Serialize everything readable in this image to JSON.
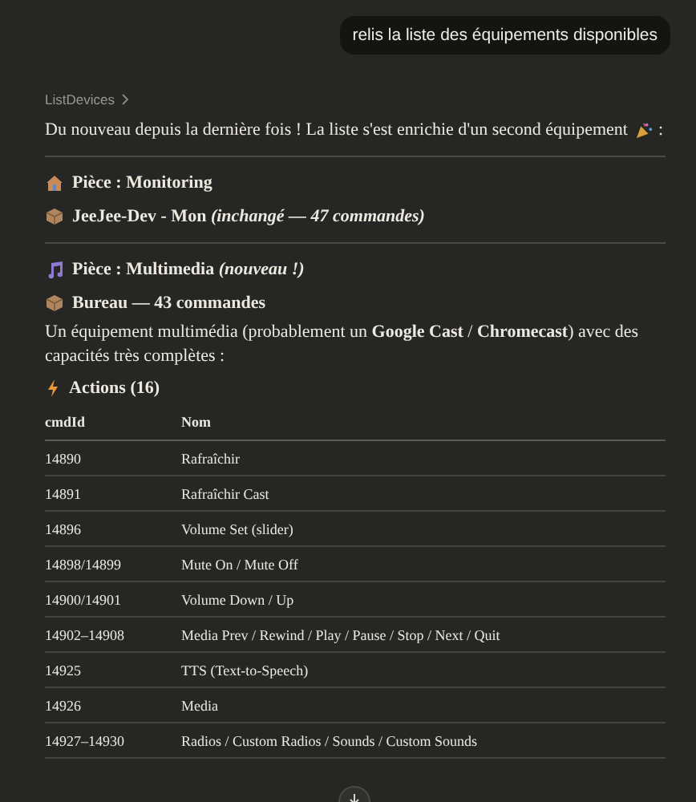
{
  "user_message": "relis la liste des équipements disponibles",
  "breadcrumb": "ListDevices",
  "intro": "Du nouveau depuis la dernière fois ! La liste s'est enrichie d'un second équipement",
  "intro_end": ":",
  "rooms": [
    {
      "title": "Pièce : Monitoring",
      "devices": [
        {
          "title": "JeeJee-Dev - Mon *(inchangé — 47 commandes)*"
        }
      ]
    },
    {
      "title": "Pièce : Multimedia *(nouveau !)*",
      "devices": [
        {
          "title": "Bureau — 43 commandes",
          "description": "Un équipement multimédia (probablement un **Google Cast** / **Chromecast**) avec des capacités très complètes :",
          "actions": {
            "title": "Actions (16)",
            "columns": [
              "cmdId",
              "Nom"
            ],
            "rows": [
              [
                "14890",
                "Rafraîchir"
              ],
              [
                "14891",
                "Rafraîchir Cast"
              ],
              [
                "14896",
                "Volume Set (slider)"
              ],
              [
                "14898/14899",
                "Mute On / Mute Off"
              ],
              [
                "14900/14901",
                "Volume Down / Up"
              ],
              [
                "14902–14908",
                "Media Prev / Rewind / Play / Pause / Stop / Next / Quit"
              ],
              [
                "14925",
                "TTS (Text-to-Speech)"
              ],
              [
                "14926",
                "Media"
              ],
              [
                "14927–14930",
                "Radios / Custom Radios / Sounds / Custom Sounds"
              ]
            ]
          }
        }
      ]
    }
  ]
}
